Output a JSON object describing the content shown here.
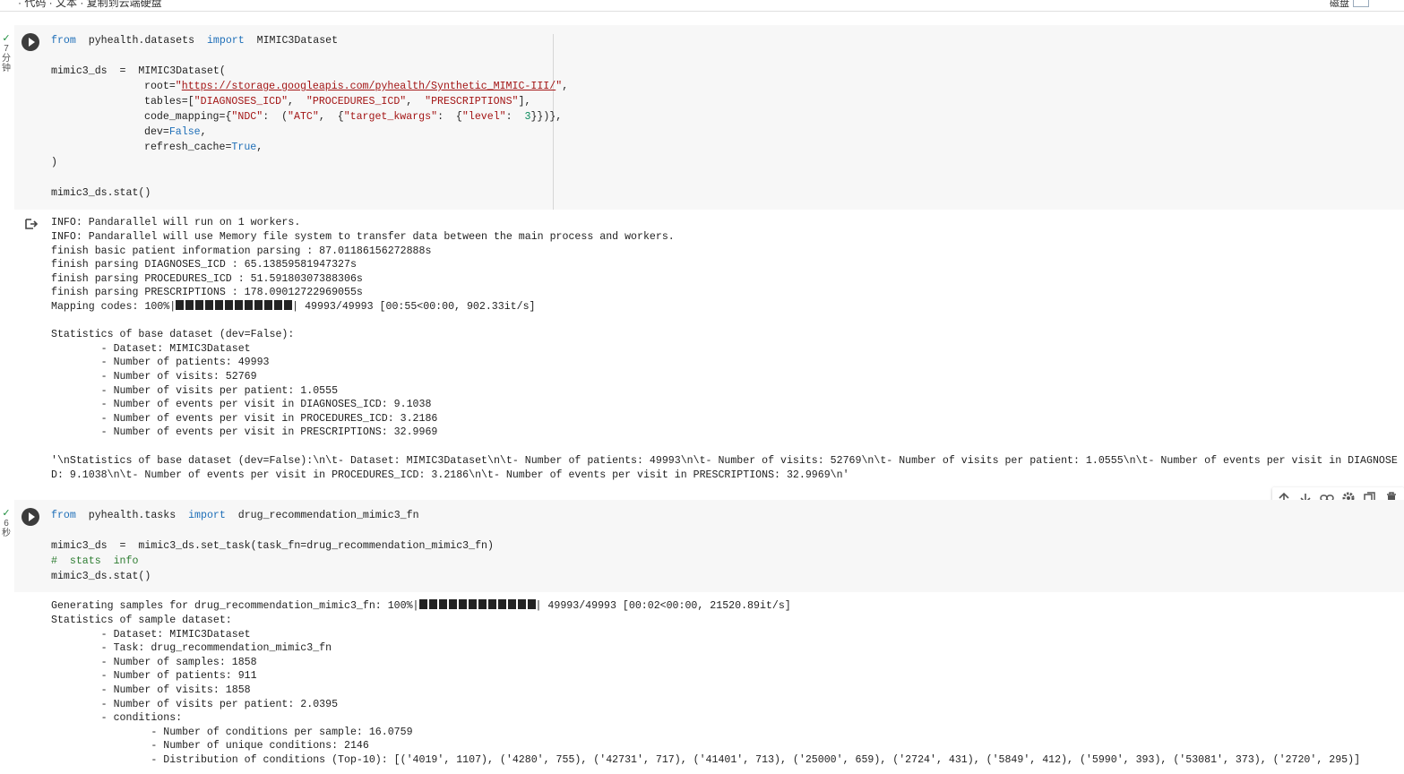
{
  "topbar": {
    "cut_text": "· 代码 · 文本 · 复制到云端硬盘",
    "right_text": "磁盘"
  },
  "cell1": {
    "status": [
      "✓",
      "7",
      "分",
      "钟"
    ],
    "code": {
      "l1": {
        "kw1": "from",
        "mod": "pyhealth.datasets",
        "kw2": "import",
        "name": "MIMIC3Dataset"
      },
      "l2": {
        "a": "mimic3_ds  =  MIMIC3Dataset("
      },
      "l3": {
        "a": "root=",
        "q1": "\"",
        "url": "https://storage.googleapis.com/pyhealth/Synthetic_MIMIC-III/",
        "q2": "\"",
        "b": ","
      },
      "l4": {
        "a": "tables=[",
        "s1": "\"DIAGNOSES_ICD\"",
        "c1": ",  ",
        "s2": "\"PROCEDURES_ICD\"",
        "c2": ",  ",
        "s3": "\"PRESCRIPTIONS\"",
        "b": "],"
      },
      "l5": {
        "a": "code_mapping={",
        "s1": "\"NDC\"",
        "c1": ":  (",
        "s2": "\"ATC\"",
        "c2": ",  {",
        "s3": "\"target_kwargs\"",
        "c3": ":  {",
        "s4": "\"level\"",
        "c4": ":  ",
        "n": "3",
        "b": "}})},"
      },
      "l6": {
        "a": "dev=",
        "v": "False",
        "b": ","
      },
      "l7": {
        "a": "refresh_cache=",
        "v": "True",
        "b": ","
      },
      "l8": {
        "a": ")"
      },
      "l9": {
        "a": "mimic3_ds.stat()"
      }
    },
    "output": [
      "INFO: Pandarallel will run on 1 workers.",
      "INFO: Pandarallel will use Memory file system to transfer data between the main process and workers.",
      "finish basic patient information parsing : 87.01186156272888s",
      "finish parsing DIAGNOSES_ICD : 65.13859581947327s",
      "finish parsing PROCEDURES_ICD : 51.59180307388306s",
      "finish parsing PRESCRIPTIONS : 178.09012722969055s",
      "",
      "",
      "Statistics of base dataset (dev=False):",
      "        - Dataset: MIMIC3Dataset",
      "        - Number of patients: 49993",
      "        - Number of visits: 52769",
      "        - Number of visits per patient: 1.0555",
      "        - Number of events per visit in DIAGNOSES_ICD: 9.1038",
      "        - Number of events per visit in PROCEDURES_ICD: 3.2186",
      "        - Number of events per visit in PRESCRIPTIONS: 32.9969",
      "",
      "'\\nStatistics of base dataset (dev=False):\\n\\t- Dataset: MIMIC3Dataset\\n\\t- Number of patients: 49993\\n\\t- Number of visits: 52769\\n\\t- Number of visits per patient: 1.0555\\n\\t- Number of events per visit in DIAGNOSE",
      "D: 9.1038\\n\\t- Number of events per visit in PROCEDURES_ICD: 3.2186\\n\\t- Number of events per visit in PRESCRIPTIONS: 32.9969\\n'"
    ],
    "progress": {
      "prefix": "Mapping codes: 100%|",
      "suffix": "| 49993/49993 [00:55<00:00, 902.33it/s]",
      "fraction": 1.0
    }
  },
  "cell2": {
    "status": [
      "✓",
      "6",
      "秒"
    ],
    "code": {
      "l1": {
        "kw1": "from",
        "mod": "pyhealth.tasks",
        "kw2": "import",
        "name": "drug_recommendation_mimic3_fn"
      },
      "l2": {
        "a": "mimic3_ds  =  mimic3_ds.set_task(task_fn=drug_recommendation_mimic3_fn)"
      },
      "l3": {
        "a": "#  stats  info"
      },
      "l4": {
        "a": "mimic3_ds.stat()"
      }
    },
    "progress": {
      "prefix": "Generating samples for drug_recommendation_mimic3_fn: 100%|",
      "suffix": "| 49993/49993 [00:02<00:00, 21520.89it/s]",
      "fraction": 1.0
    },
    "output": [
      "Statistics of sample dataset:",
      "        - Dataset: MIMIC3Dataset",
      "        - Task: drug_recommendation_mimic3_fn",
      "        - Number of samples: 1858",
      "        - Number of patients: 911",
      "        - Number of visits: 1858",
      "        - Number of visits per patient: 2.0395",
      "        - conditions:",
      "                - Number of conditions per sample: 16.0759",
      "                - Number of unique conditions: 2146",
      "                - Distribution of conditions (Top-10): [('4019', 1107), ('4280', 755), ('42731', 717), ('41401', 713), ('25000', 659), ('2724', 431), ('5849', 412), ('5990', 393), ('53081', 373), ('2720', 295)]"
    ]
  },
  "toolbar": {
    "icons": [
      "move-up-icon",
      "move-down-icon",
      "link-icon",
      "settings-icon",
      "mirror-cell-icon",
      "delete-icon"
    ]
  }
}
